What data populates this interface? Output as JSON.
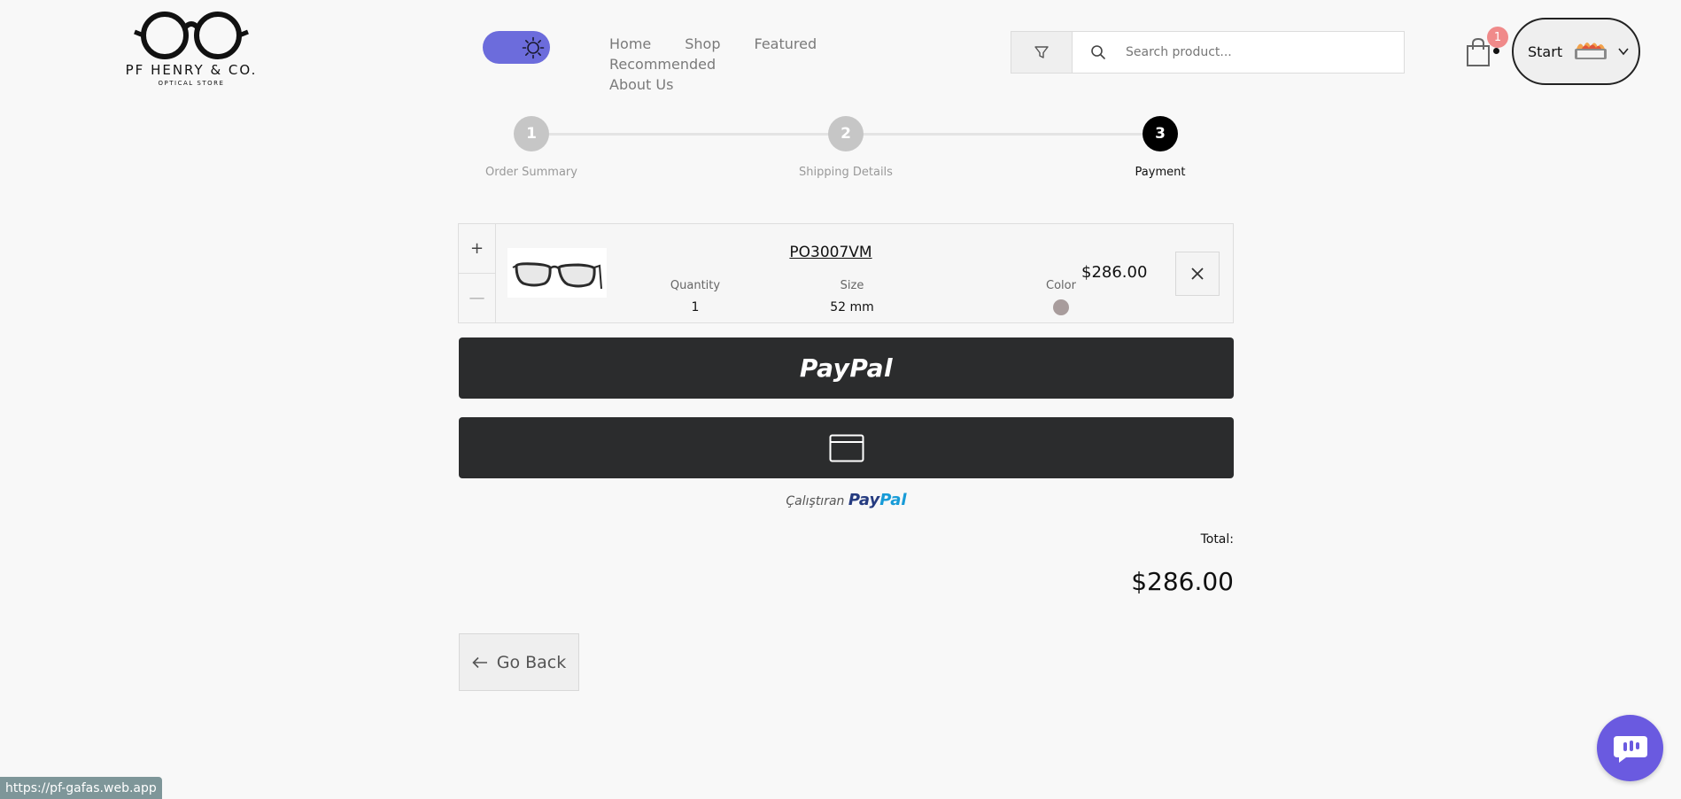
{
  "brand": {
    "name": "PF HENRY & CO.",
    "tagline": "OPTICAL STORE"
  },
  "nav": {
    "items": [
      "Home",
      "Shop",
      "Featured",
      "Recommended",
      "About Us"
    ]
  },
  "search": {
    "placeholder": "Search product..."
  },
  "cart": {
    "count": "1"
  },
  "user": {
    "label": "Start"
  },
  "stepper": {
    "steps": [
      {
        "number": "1",
        "label": "Order Summary",
        "state": "done"
      },
      {
        "number": "2",
        "label": "Shipping Details",
        "state": "done"
      },
      {
        "number": "3",
        "label": "Payment",
        "state": "active"
      }
    ]
  },
  "product": {
    "qty_plus": "+",
    "qty_minus": "—",
    "name": "PO3007VM",
    "quantity_label": "Quantity",
    "quantity": "1",
    "size_label": "Size",
    "size": "52 mm",
    "color_label": "Color",
    "color_hex": "#a89c9c",
    "price": "$286.00"
  },
  "payment": {
    "paypal_label": "PayPal",
    "powered_prefix": "Çalıştıran",
    "powered_brand_a": "Pay",
    "powered_brand_b": "Pal"
  },
  "total": {
    "label": "Total:",
    "value": "$286.00"
  },
  "back": {
    "label": "Go Back"
  },
  "status_url": "https://pf-gafas.web.app",
  "colors": {
    "accent": "#6c6cdc",
    "chat": "#6a5ae0",
    "badge": "#f08a8a",
    "dark_button": "#2b2c2d"
  }
}
